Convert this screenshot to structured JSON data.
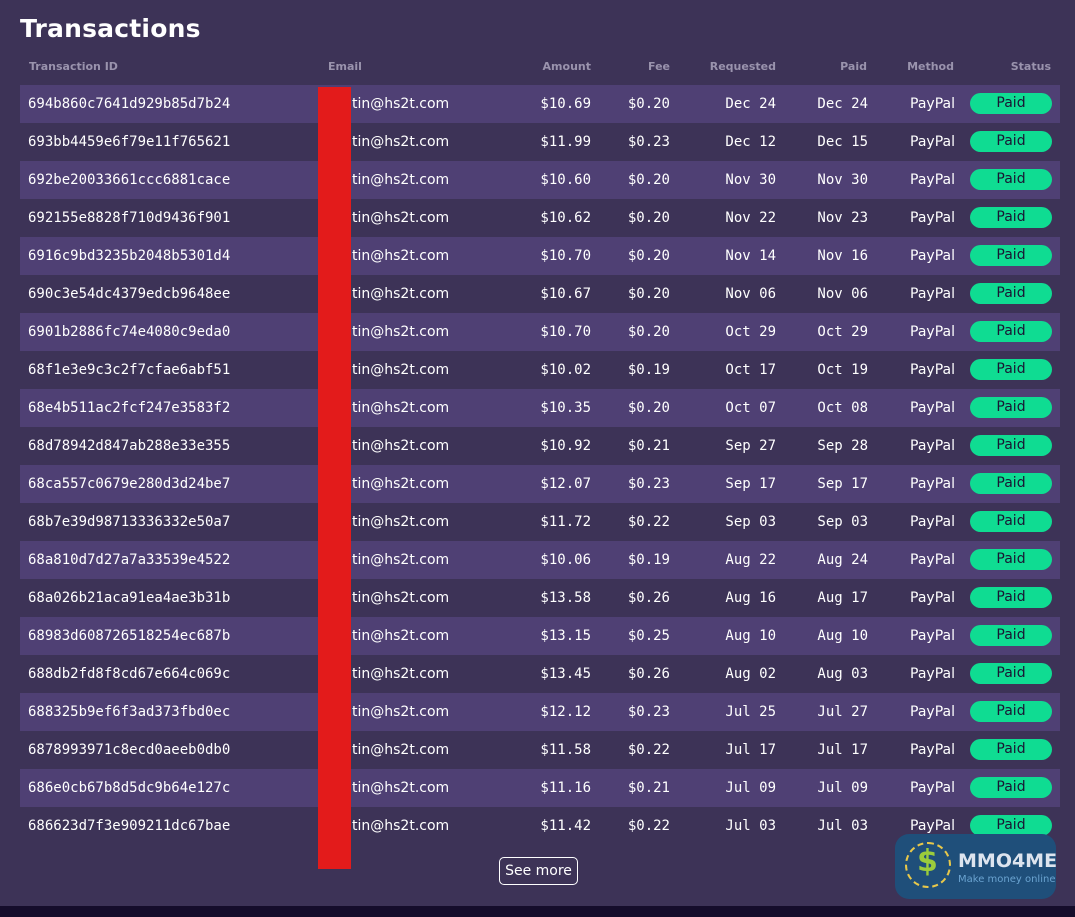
{
  "title": "Transactions",
  "columns": [
    "Transaction ID",
    "Email",
    "Amount",
    "Fee",
    "Requested",
    "Paid",
    "Method",
    "Status"
  ],
  "rows": [
    {
      "id": "694b860c7641d929b85d7b24",
      "email": "tin@hs2t.com",
      "amount": "$10.69",
      "fee": "$0.20",
      "requested": "Dec 24",
      "paid": "Dec 24",
      "method": "PayPal",
      "status": "Paid"
    },
    {
      "id": "693bb4459e6f79e11f765621",
      "email": "tin@hs2t.com",
      "amount": "$11.99",
      "fee": "$0.23",
      "requested": "Dec 12",
      "paid": "Dec 15",
      "method": "PayPal",
      "status": "Paid"
    },
    {
      "id": "692be20033661ccc6881cace",
      "email": "tin@hs2t.com",
      "amount": "$10.60",
      "fee": "$0.20",
      "requested": "Nov 30",
      "paid": "Nov 30",
      "method": "PayPal",
      "status": "Paid"
    },
    {
      "id": "692155e8828f710d9436f901",
      "email": "tin@hs2t.com",
      "amount": "$10.62",
      "fee": "$0.20",
      "requested": "Nov 22",
      "paid": "Nov 23",
      "method": "PayPal",
      "status": "Paid"
    },
    {
      "id": "6916c9bd3235b2048b5301d4",
      "email": "tin@hs2t.com",
      "amount": "$10.70",
      "fee": "$0.20",
      "requested": "Nov 14",
      "paid": "Nov 16",
      "method": "PayPal",
      "status": "Paid"
    },
    {
      "id": "690c3e54dc4379edcb9648ee",
      "email": "tin@hs2t.com",
      "amount": "$10.67",
      "fee": "$0.20",
      "requested": "Nov 06",
      "paid": "Nov 06",
      "method": "PayPal",
      "status": "Paid"
    },
    {
      "id": "6901b2886fc74e4080c9eda0",
      "email": "tin@hs2t.com",
      "amount": "$10.70",
      "fee": "$0.20",
      "requested": "Oct 29",
      "paid": "Oct 29",
      "method": "PayPal",
      "status": "Paid"
    },
    {
      "id": "68f1e3e9c3c2f7cfae6abf51",
      "email": "tin@hs2t.com",
      "amount": "$10.02",
      "fee": "$0.19",
      "requested": "Oct 17",
      "paid": "Oct 19",
      "method": "PayPal",
      "status": "Paid"
    },
    {
      "id": "68e4b511ac2fcf247e3583f2",
      "email": "tin@hs2t.com",
      "amount": "$10.35",
      "fee": "$0.20",
      "requested": "Oct 07",
      "paid": "Oct 08",
      "method": "PayPal",
      "status": "Paid"
    },
    {
      "id": "68d78942d847ab288e33e355",
      "email": "tin@hs2t.com",
      "amount": "$10.92",
      "fee": "$0.21",
      "requested": "Sep 27",
      "paid": "Sep 28",
      "method": "PayPal",
      "status": "Paid"
    },
    {
      "id": "68ca557c0679e280d3d24be7",
      "email": "tin@hs2t.com",
      "amount": "$12.07",
      "fee": "$0.23",
      "requested": "Sep 17",
      "paid": "Sep 17",
      "method": "PayPal",
      "status": "Paid"
    },
    {
      "id": "68b7e39d98713336332e50a7",
      "email": "tin@hs2t.com",
      "amount": "$11.72",
      "fee": "$0.22",
      "requested": "Sep 03",
      "paid": "Sep 03",
      "method": "PayPal",
      "status": "Paid"
    },
    {
      "id": "68a810d7d27a7a33539e4522",
      "email": "tin@hs2t.com",
      "amount": "$10.06",
      "fee": "$0.19",
      "requested": "Aug 22",
      "paid": "Aug 24",
      "method": "PayPal",
      "status": "Paid"
    },
    {
      "id": "68a026b21aca91ea4ae3b31b",
      "email": "tin@hs2t.com",
      "amount": "$13.58",
      "fee": "$0.26",
      "requested": "Aug 16",
      "paid": "Aug 17",
      "method": "PayPal",
      "status": "Paid"
    },
    {
      "id": "68983d608726518254ec687b",
      "email": "tin@hs2t.com",
      "amount": "$13.15",
      "fee": "$0.25",
      "requested": "Aug 10",
      "paid": "Aug 10",
      "method": "PayPal",
      "status": "Paid"
    },
    {
      "id": "688db2fd8f8cd67e664c069c",
      "email": "tin@hs2t.com",
      "amount": "$13.45",
      "fee": "$0.26",
      "requested": "Aug 02",
      "paid": "Aug 03",
      "method": "PayPal",
      "status": "Paid"
    },
    {
      "id": "688325b9ef6f3ad373fbd0ec",
      "email": "tin@hs2t.com",
      "amount": "$12.12",
      "fee": "$0.23",
      "requested": "Jul 25",
      "paid": "Jul 27",
      "method": "PayPal",
      "status": "Paid"
    },
    {
      "id": "6878993971c8ecd0aeeb0db0",
      "email": "tin@hs2t.com",
      "amount": "$11.58",
      "fee": "$0.22",
      "requested": "Jul 17",
      "paid": "Jul 17",
      "method": "PayPal",
      "status": "Paid"
    },
    {
      "id": "686e0cb67b8d5dc9b64e127c",
      "email": "tin@hs2t.com",
      "amount": "$11.16",
      "fee": "$0.21",
      "requested": "Jul 09",
      "paid": "Jul 09",
      "method": "PayPal",
      "status": "Paid"
    },
    {
      "id": "686623d7f3e909211dc67bae",
      "email": "tin@hs2t.com",
      "amount": "$11.42",
      "fee": "$0.22",
      "requested": "Jul 03",
      "paid": "Jul 03",
      "method": "PayPal",
      "status": "Paid"
    }
  ],
  "see_more_label": "See more",
  "watermark": {
    "name": "MMO4ME",
    "tagline": "Make money online"
  },
  "colors": {
    "background": "#3d3357",
    "row_alt": "#4f4074",
    "status_paid": "#0fdc92",
    "redaction": "#e31b1b"
  }
}
